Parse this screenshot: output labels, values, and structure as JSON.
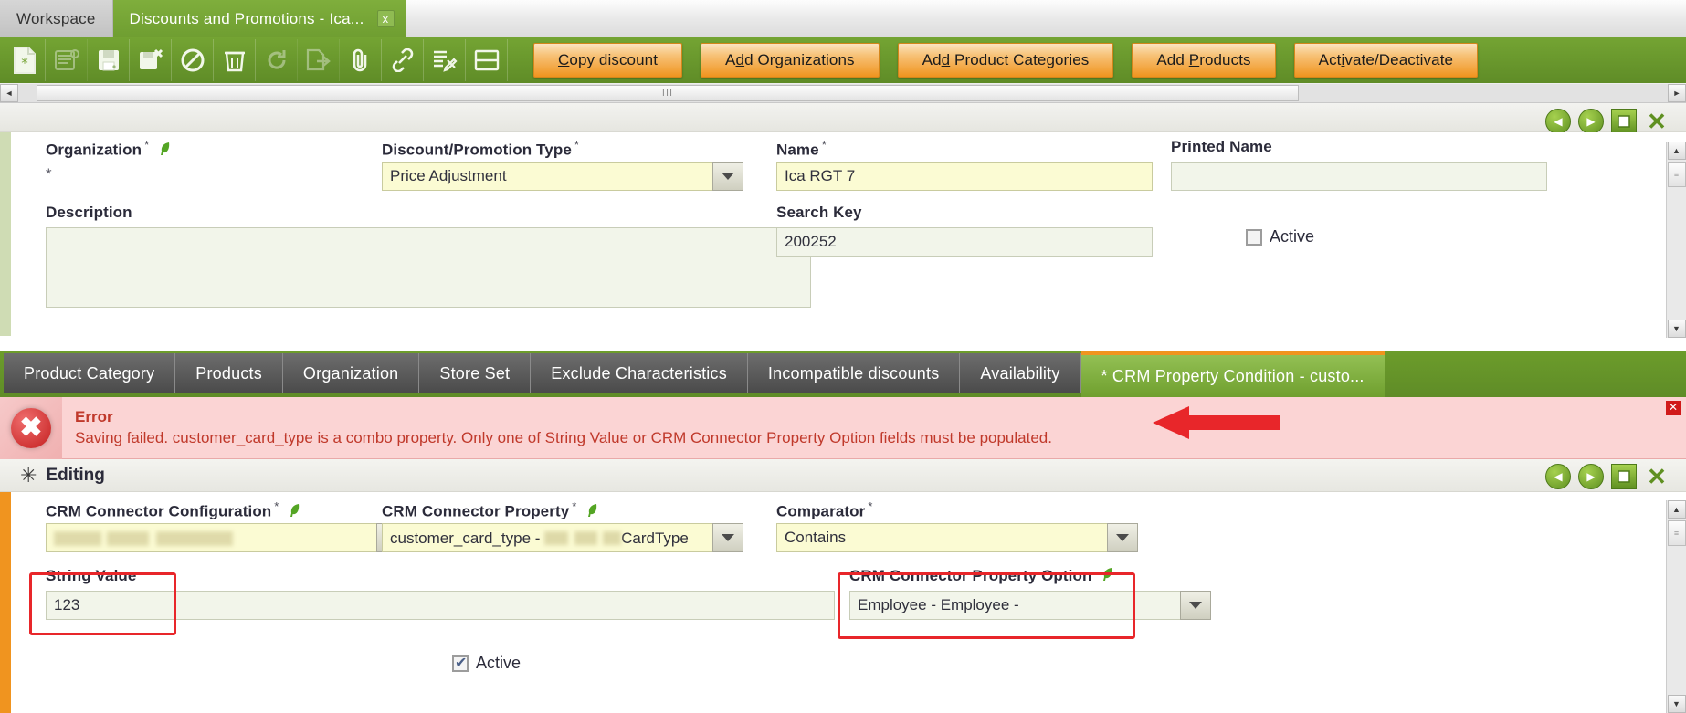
{
  "window": {
    "tabs": [
      {
        "label": "Workspace",
        "active": false,
        "closable": false
      },
      {
        "label": "Discounts and Promotions - Ica...",
        "active": true,
        "closable": true,
        "close_glyph": "x"
      }
    ]
  },
  "toolbar": {
    "icons": [
      {
        "name": "new-document-icon",
        "enabled": true
      },
      {
        "name": "new-from-template-icon",
        "enabled": false
      },
      {
        "name": "save-icon",
        "enabled": true
      },
      {
        "name": "save-close-icon",
        "enabled": true
      },
      {
        "name": "cancel-icon",
        "enabled": true
      },
      {
        "name": "delete-icon",
        "enabled": true
      },
      {
        "name": "refresh-icon",
        "enabled": false
      },
      {
        "name": "export-icon",
        "enabled": false
      },
      {
        "name": "attachment-icon",
        "enabled": true
      },
      {
        "name": "link-icon",
        "enabled": true
      },
      {
        "name": "preferences-icon",
        "enabled": true
      },
      {
        "name": "grid-view-icon",
        "enabled": true
      }
    ],
    "buttons": [
      {
        "label": "Copy discount",
        "accel_index": 0
      },
      {
        "label": "Add Organizations",
        "accel_index": 1
      },
      {
        "label": "Add Product Categories",
        "accel_index": 2
      },
      {
        "label": "Add Products",
        "accel_index": 4
      },
      {
        "label": "Activate/Deactivate",
        "accel_index": 3
      }
    ]
  },
  "scrollbars": {
    "h_thumb_glyph": "III",
    "left_arrow": "◄",
    "right_arrow": "►",
    "up_arrow": "▲",
    "down_arrow": "▼",
    "thumb_grip": "≡"
  },
  "record_header": {
    "prev_label": "◀",
    "next_label": "▶",
    "maximize_label": "▣",
    "close_label": "✕"
  },
  "form": {
    "organization": {
      "label": "Organization",
      "required_mark": "*",
      "value": "*",
      "has_leaf_icon": true
    },
    "discount_type": {
      "label": "Discount/Promotion Type",
      "required_mark": "*",
      "value": "Price Adjustment",
      "placeholder": ""
    },
    "name": {
      "label": "Name",
      "required_mark": "*",
      "value": "Ica RGT 7",
      "placeholder": ""
    },
    "printed_name": {
      "label": "Printed Name",
      "value": "",
      "placeholder": ""
    },
    "description": {
      "label": "Description",
      "value": "",
      "placeholder": ""
    },
    "search_key": {
      "label": "Search Key",
      "value": "200252",
      "placeholder": ""
    },
    "active": {
      "label": "Active",
      "checked": false
    }
  },
  "subtabs": [
    {
      "label": "Product Category",
      "active": false
    },
    {
      "label": "Products",
      "active": false
    },
    {
      "label": "Organization",
      "active": false
    },
    {
      "label": "Store Set",
      "active": false
    },
    {
      "label": "Exclude Characteristics",
      "active": false
    },
    {
      "label": "Incompatible discounts",
      "active": false
    },
    {
      "label": "Availability",
      "active": false
    },
    {
      "label": "* CRM Property Condition - custo...",
      "active": true
    }
  ],
  "error": {
    "title": "Error",
    "message": "Saving failed. customer_card_type is a combo property. Only one of String Value or CRM Connector Property Option fields must be populated.",
    "icon_glyph": "✖",
    "close_glyph": "✕"
  },
  "editing": {
    "title": "Editing",
    "star_glyph": "✳",
    "prev_label": "◀",
    "next_label": "▶",
    "maximize_label": "▣",
    "close_label": "✕",
    "fields": {
      "crm_connector_configuration": {
        "label": "CRM Connector Configuration",
        "required_mark": "*",
        "value": "",
        "redacted": true,
        "has_leaf_icon": true
      },
      "crm_connector_property": {
        "label": "CRM Connector Property",
        "required_mark": "*",
        "value_prefix": "customer_card_type - ",
        "value_suffix": "CardType",
        "redacted_middle": true,
        "has_leaf_icon": true
      },
      "comparator": {
        "label": "Comparator",
        "required_mark": "*",
        "value": "Contains"
      },
      "string_value": {
        "label": "String Value",
        "value": "123",
        "highlighted": true
      },
      "crm_connector_property_option": {
        "label": "CRM Connector Property Option",
        "value": "Employee - Employee - ",
        "has_leaf_icon": true,
        "highlighted": true
      },
      "active": {
        "label": "Active",
        "checked": true
      }
    }
  },
  "colors": {
    "toolbar_green": "#74a433",
    "button_orange": "#f0941f",
    "error_bg": "#fbd4d4",
    "error_text": "#c0392b",
    "highlight_red": "#e8262a",
    "field_yellow": "#fbfbd3",
    "field_gray": "#f2f5ea"
  }
}
